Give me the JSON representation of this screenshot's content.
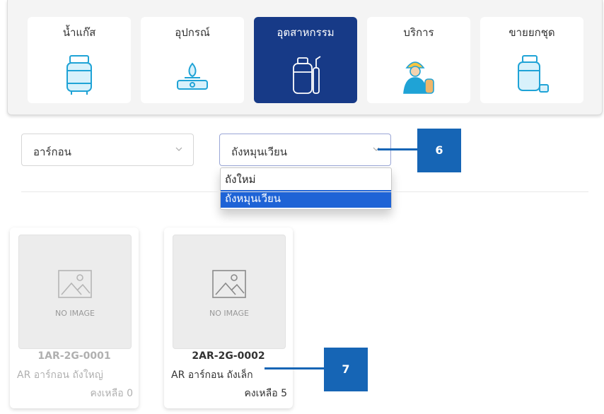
{
  "categories": [
    {
      "label": "น้ำแก๊ส",
      "icon": "gas-tank-icon",
      "active": false
    },
    {
      "label": "อุปกรณ์",
      "icon": "gas-stove-icon",
      "active": false
    },
    {
      "label": "อุตสาหกรรม",
      "icon": "industrial-cylinder-icon",
      "active": true
    },
    {
      "label": "บริการ",
      "icon": "technician-icon",
      "active": false
    },
    {
      "label": "ขายยกชุด",
      "icon": "gas-set-icon",
      "active": false
    }
  ],
  "filters": {
    "product_select": {
      "value": "อาร์กอน"
    },
    "tank_type_select": {
      "value": "ถังหมุนเวียน",
      "options": [
        "ถังใหม่",
        "ถังหมุนเวียน"
      ],
      "selected_index": 1
    }
  },
  "products": [
    {
      "placeholder": "NO IMAGE",
      "code": "1AR-2G-0001",
      "name": "AR อาร์กอน ถังใหญ่",
      "stock": "คงเหลือ 0",
      "available": false
    },
    {
      "placeholder": "NO IMAGE",
      "code": "2AR-2G-0002",
      "name": "AR อาร์กอน ถังเล็ก",
      "stock": "คงเหลือ 5",
      "available": true
    }
  ],
  "annotations": [
    {
      "label": "6"
    },
    {
      "label": "7"
    }
  ],
  "colors": {
    "accent": "#173a87",
    "selected_option": "#1e63d6",
    "callout": "#1665b5"
  }
}
